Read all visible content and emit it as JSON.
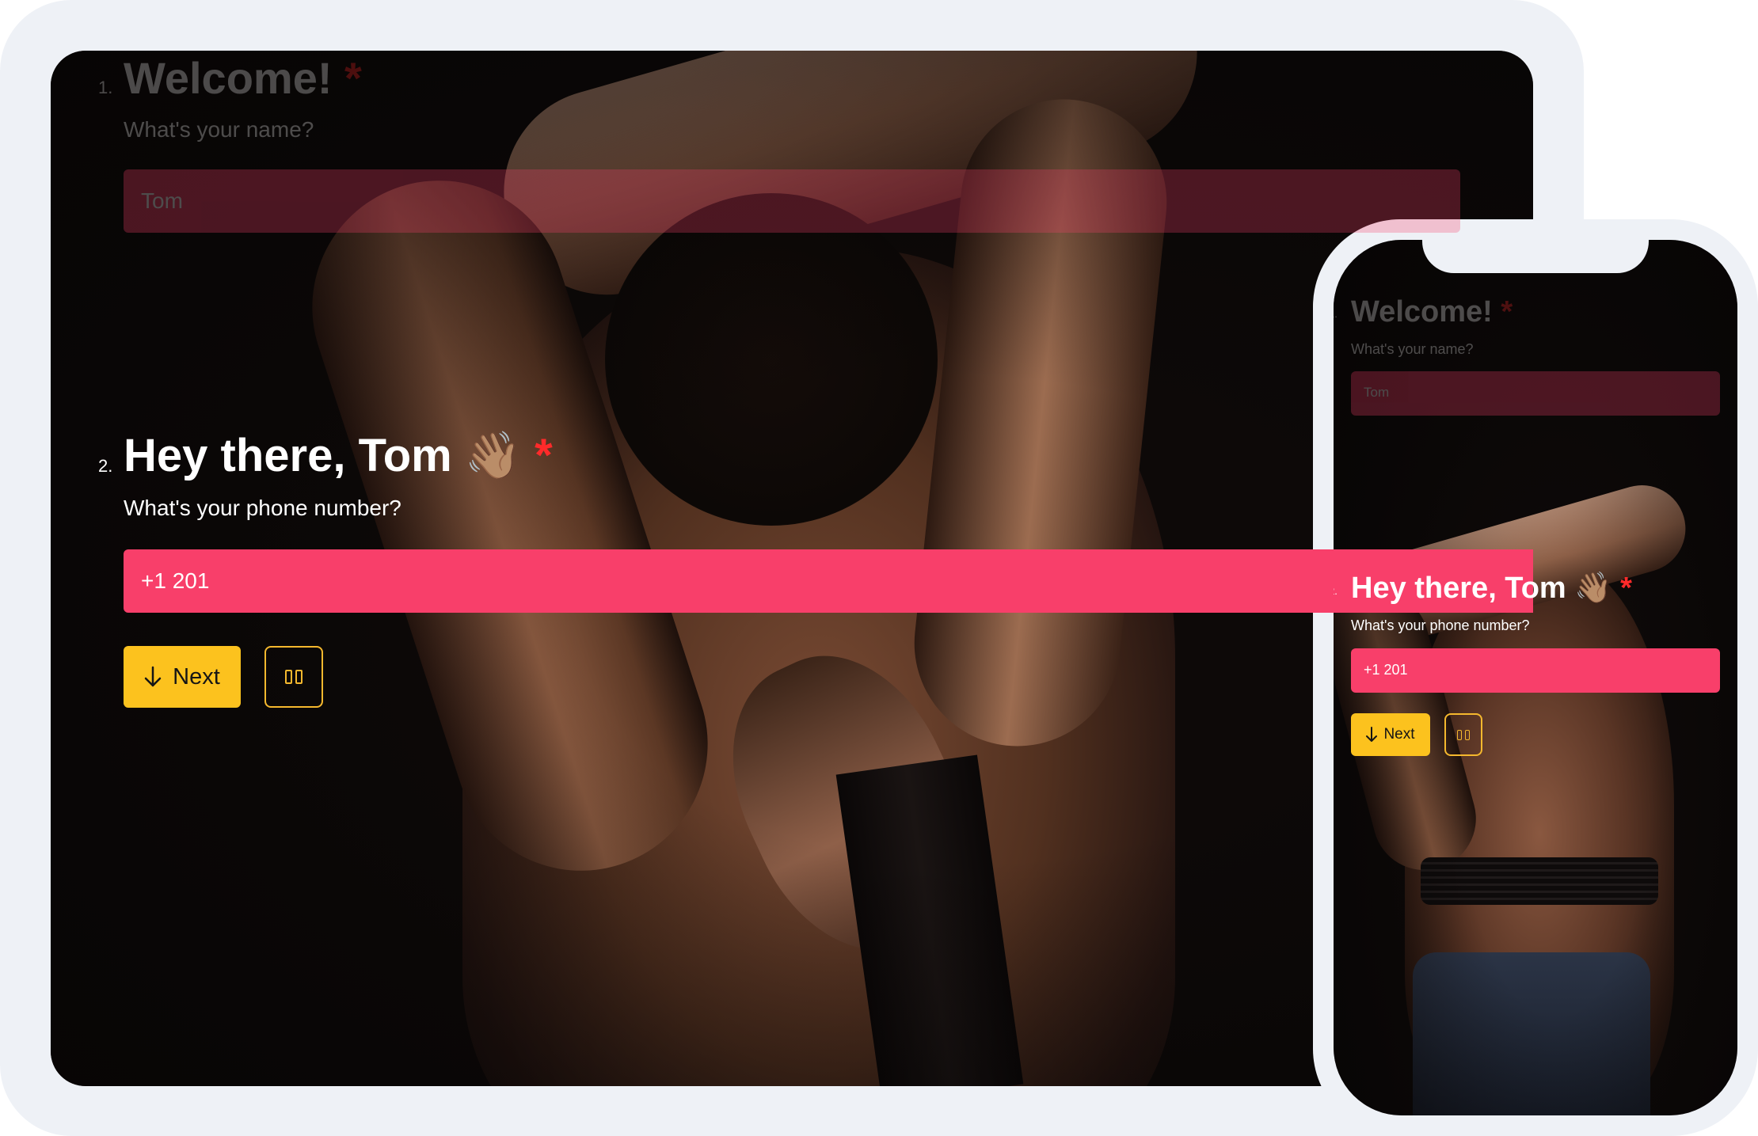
{
  "questions": [
    {
      "number": "1.",
      "title": "Welcome!",
      "required_mark": "*",
      "subtitle": "What's your name?",
      "value": "Tom"
    },
    {
      "number": "2.",
      "title": "Hey there, Tom",
      "emoji": "👋🏽",
      "required_mark": "*",
      "subtitle": "What's your phone number?",
      "value": "+1 201"
    }
  ],
  "buttons": {
    "next_label": "Next",
    "next_icon": "arrow-down-icon",
    "keyboard_icon": "keyboard-icon"
  },
  "colors": {
    "accent_field": "#f83f6a",
    "button": "#fcc21e",
    "required": "#ff2a2a",
    "frame": "#eef1f6"
  }
}
